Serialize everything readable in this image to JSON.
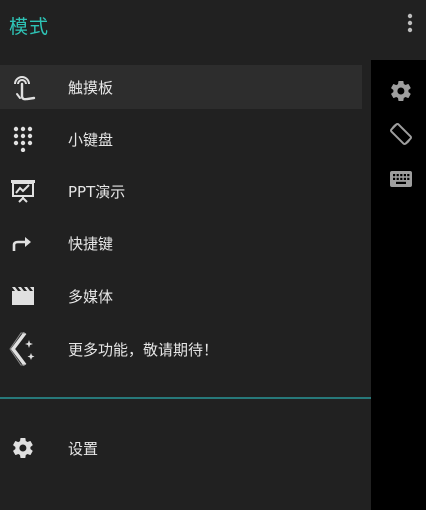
{
  "drawer": {
    "title": "模式",
    "items": [
      {
        "label": "触摸板",
        "icon": "touchpad-icon",
        "active": true
      },
      {
        "label": "小键盘",
        "icon": "numpad-icon",
        "active": false
      },
      {
        "label": "PPT演示",
        "icon": "presentation-icon",
        "active": false
      },
      {
        "label": "快捷键",
        "icon": "shortcut-arrow-icon",
        "active": false
      },
      {
        "label": "多媒体",
        "icon": "media-clapper-icon",
        "active": false
      },
      {
        "label": "更多功能，敬请期待！",
        "icon": "more-features-icon",
        "active": false
      }
    ],
    "settings": {
      "label": "设置",
      "icon": "gear-icon"
    }
  },
  "toolbar": {
    "overflow_icon": "more-vert-icon",
    "side_icons": [
      "gear-icon",
      "screen-rotation-icon",
      "keyboard-icon"
    ]
  },
  "colors": {
    "accent": "#2ec4b6",
    "drawer_bg": "#212121",
    "active_bg": "#2d2d2d",
    "divider": "#27797a",
    "text": "#e6e6e6",
    "icon": "#e0e0e0"
  }
}
